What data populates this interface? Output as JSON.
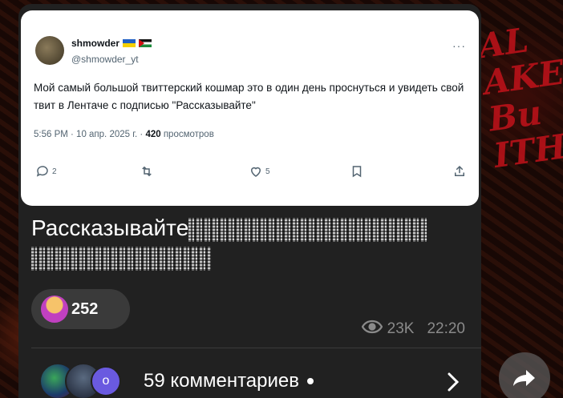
{
  "tweet": {
    "name": "shmowder",
    "handle": "@shmowder_yt",
    "more": "···",
    "text": "Мой самый большой твиттерский кошмар это в один день проснуться и увидеть свой твит в Лентаче с подписью \"Рассказывайте\"",
    "time_date": "5:56 PM · 10 апр. 2025 г. · ",
    "views_count": "420",
    "views_label": " просмотров",
    "replies": "2",
    "likes": "5"
  },
  "message": {
    "caption": "Рассказывайте",
    "reaction_count": "252",
    "views": "23K",
    "time": "22:20"
  },
  "comments": {
    "extra_avatar_letter": "o",
    "label": "59 комментариев"
  },
  "background_text": "AL\nAKE\nBu\nITH",
  "colors": {
    "post_bg": "#212121",
    "tweet_bg": "#ffffff",
    "background_accent": "#c1121a"
  }
}
